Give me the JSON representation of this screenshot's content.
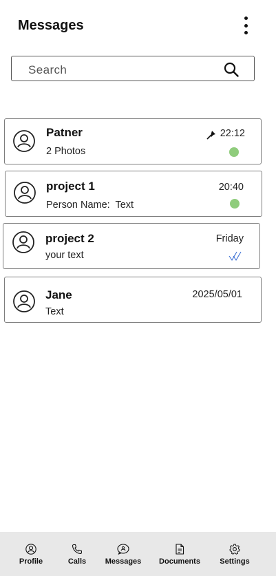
{
  "header": {
    "title": "Messages",
    "menu_icon": "more-vertical-icon"
  },
  "search": {
    "placeholder": "Search",
    "icon": "search-icon"
  },
  "conversations": [
    {
      "name": "Patner",
      "preview": "2 Photos",
      "time": "22:12",
      "pinned": true,
      "status": "unread",
      "status_color": "#8fcc7c"
    },
    {
      "name": "project 1",
      "preview": "Person Name:  Text",
      "time": "20:40",
      "pinned": false,
      "status": "unread",
      "status_color": "#8fcc7c"
    },
    {
      "name": "project 2",
      "preview": "your text",
      "time": "Friday",
      "pinned": false,
      "status": "read",
      "status_color": "#3b6fd4"
    },
    {
      "name": "Jane",
      "preview": "Text",
      "time": "2025/05/01",
      "pinned": false,
      "status": "none"
    }
  ],
  "bottom_nav": [
    {
      "label": "Profile",
      "icon": "profile-icon"
    },
    {
      "label": "Calls",
      "icon": "phone-icon"
    },
    {
      "label": "Messages",
      "icon": "messages-icon"
    },
    {
      "label": "Documents",
      "icon": "document-icon"
    },
    {
      "label": "Settings",
      "icon": "settings-icon"
    }
  ]
}
